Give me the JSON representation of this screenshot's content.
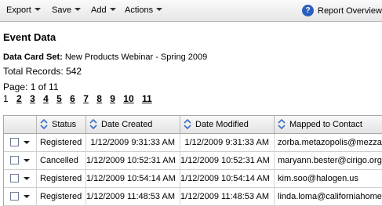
{
  "toolbar": {
    "export_label": "Export",
    "save_label": "Save",
    "add_label": "Add",
    "actions_label": "Actions",
    "help_icon": "help-icon",
    "report_label": "Report Overview"
  },
  "page": {
    "title": "Event Data",
    "data_card_set_label": "Data Card Set:",
    "data_card_set_value": "New Products Webinar - Spring 2009",
    "total_records": "Total Records: 542",
    "page_info": "Page: 1 of 11",
    "pages": [
      "1",
      "2",
      "3",
      "4",
      "5",
      "6",
      "7",
      "8",
      "9",
      "10",
      "11"
    ]
  },
  "table": {
    "columns": [
      "Status",
      "Date Created",
      "Date Modified",
      "Mapped to Contact"
    ],
    "rows": [
      [
        "Registered",
        "1/12/2009 9:31:33 AM",
        "1/12/2009 9:31:33 AM",
        "zorba.metazopolis@mezzaluna.com"
      ],
      [
        "Cancelled",
        "1/12/2009 10:52:31 AM",
        "1/12/2009 10:52:31 AM",
        "maryann.bester@cirigo.org"
      ],
      [
        "Registered",
        "1/12/2009 10:54:14 AM",
        "1/12/2009 10:54:14 AM",
        "kim.soo@halogen.us"
      ],
      [
        "Registered",
        "1/12/2009 11:48:53 AM",
        "1/12/2009 11:48:53 AM",
        "linda.loma@californiahome.com"
      ]
    ]
  },
  "colors": {
    "toolbar_bg": "#e6e6e6",
    "help_icon": "#2a5fc0",
    "sort_icon": "#3a6fc4"
  }
}
